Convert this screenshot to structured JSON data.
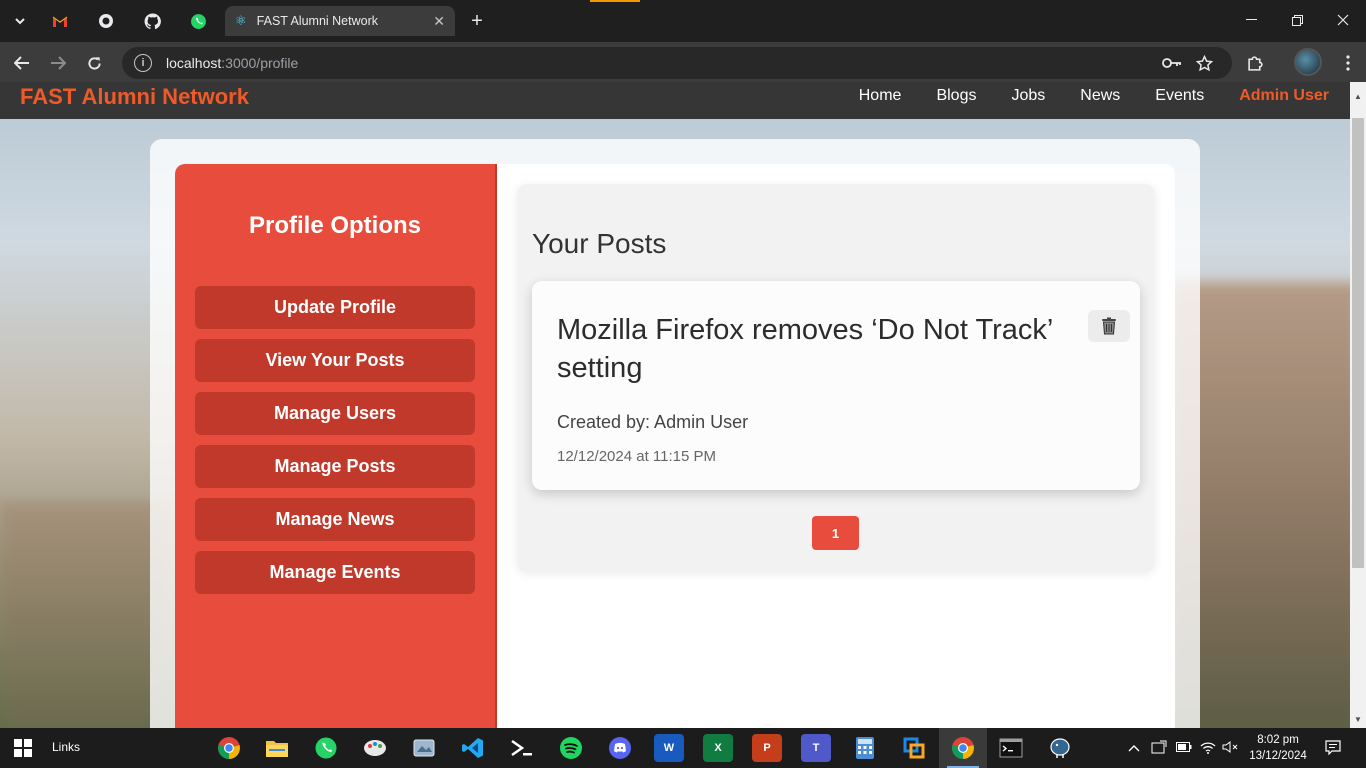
{
  "browser": {
    "tab_title": "FAST Alumni Network",
    "url_host": "localhost",
    "url_path": ":3000/profile",
    "tab_icons": [
      "chevron-down-icon",
      "gmail-icon",
      "chatgpt-icon",
      "github-icon",
      "whatsapp-icon"
    ]
  },
  "site": {
    "brand": "FAST Alumni Network",
    "nav": [
      "Home",
      "Blogs",
      "Jobs",
      "News",
      "Events"
    ],
    "user": "Admin User"
  },
  "sidebar": {
    "title": "Profile Options",
    "items": [
      "Update Profile",
      "View Your Posts",
      "Manage Users",
      "Manage Posts",
      "Manage News",
      "Manage Events"
    ]
  },
  "posts": {
    "heading": "Your Posts",
    "items": [
      {
        "title": "Mozilla Firefox removes ‘Do Not Track’ setting",
        "author": "Created by: Admin User",
        "date": "12/12/2024 at 11:15 PM"
      }
    ],
    "page": "1"
  },
  "taskbar": {
    "links": "Links",
    "time": "8:02 pm",
    "date": "13/12/2024"
  },
  "colors": {
    "accent": "#e74c3c",
    "accent_dark": "#c0392b",
    "brand_orange": "#f05a28",
    "navbar": "#363636"
  }
}
